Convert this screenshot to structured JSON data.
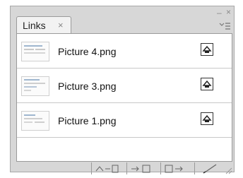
{
  "panel": {
    "tab": {
      "label": "Links",
      "close_glyph": "×"
    },
    "window_controls": {
      "minimize_glyph": "–",
      "close_glyph": "×"
    },
    "menu_icon": "panel-menu-icon",
    "links": [
      {
        "filename": "Picture 4.png",
        "status_icon": "link-status-icon"
      },
      {
        "filename": "Picture 3.png",
        "status_icon": "link-status-icon"
      },
      {
        "filename": "Picture 1.png",
        "status_icon": "link-status-icon"
      }
    ],
    "toolbar": [
      {
        "name": "relink-button",
        "icon": "relink-icon"
      },
      {
        "name": "go-to-link-button",
        "icon": "go-to-link-icon"
      },
      {
        "name": "update-link-button",
        "icon": "update-link-icon"
      },
      {
        "name": "edit-original-button",
        "icon": "edit-original-icon"
      }
    ]
  }
}
